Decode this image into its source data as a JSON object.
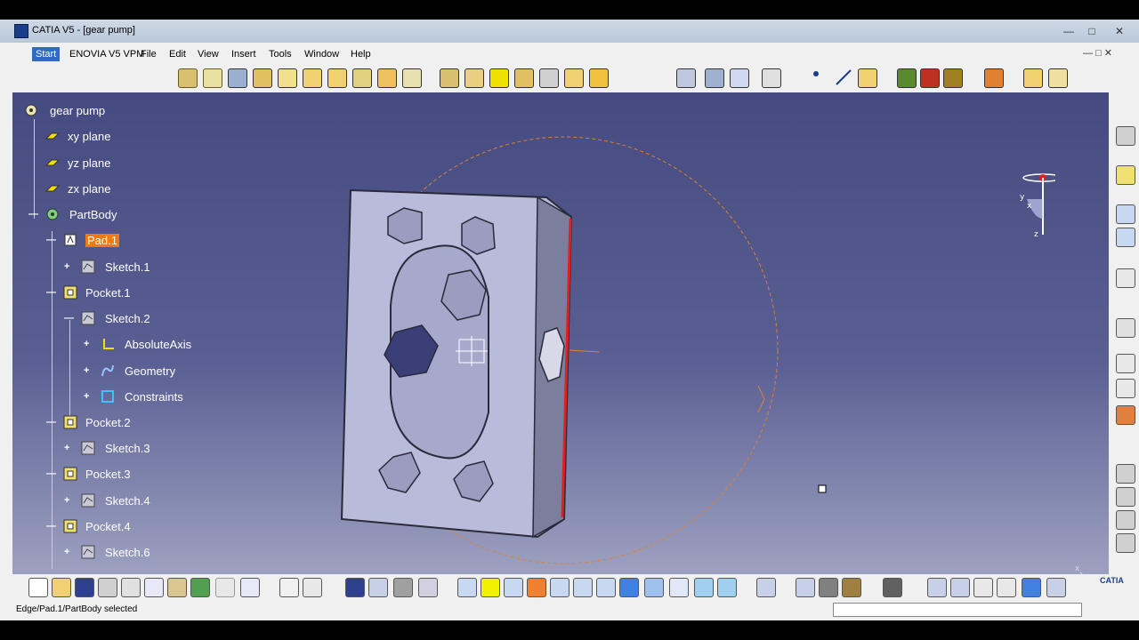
{
  "window": {
    "title": "CATIA V5 - [gear pump]"
  },
  "menu": {
    "items": [
      "Start",
      "ENOVIA V5 VPM",
      "File",
      "Edit",
      "View",
      "Insert",
      "Tools",
      "Window",
      "Help"
    ]
  },
  "tree": {
    "nodes": [
      {
        "label": "gear pump",
        "icon": "product-gear-icon"
      },
      {
        "label": "xy plane",
        "icon": "plane-icon"
      },
      {
        "label": "yz plane",
        "icon": "plane-icon"
      },
      {
        "label": "zx plane",
        "icon": "plane-icon"
      },
      {
        "label": "PartBody",
        "icon": "partbody-icon"
      },
      {
        "label": "Pad.1",
        "icon": "pad-icon",
        "selected": true
      },
      {
        "label": "Sketch.1",
        "icon": "sketch-icon"
      },
      {
        "label": "Pocket.1",
        "icon": "pocket-icon"
      },
      {
        "label": "Sketch.2",
        "icon": "sketch-icon"
      },
      {
        "label": "AbsoluteAxis",
        "icon": "axis-icon"
      },
      {
        "label": "Geometry",
        "icon": "geometry-icon"
      },
      {
        "label": "Constraints",
        "icon": "constraints-icon"
      },
      {
        "label": "Pocket.2",
        "icon": "pocket-icon"
      },
      {
        "label": "Sketch.3",
        "icon": "sketch-icon"
      },
      {
        "label": "Pocket.3",
        "icon": "pocket-icon"
      },
      {
        "label": "Sketch.4",
        "icon": "sketch-icon"
      },
      {
        "label": "Pocket.4",
        "icon": "pocket-icon"
      },
      {
        "label": "Sketch.6",
        "icon": "sketch-icon"
      }
    ]
  },
  "status": {
    "message": "Edge/Pad.1/PartBody selected"
  },
  "compass": {
    "axis_x": "x",
    "axis_y": "y",
    "axis_z": "z"
  },
  "colors": {
    "selection": "#f07a10",
    "edge_highlight": "#e02020",
    "construction": "#e08030"
  }
}
